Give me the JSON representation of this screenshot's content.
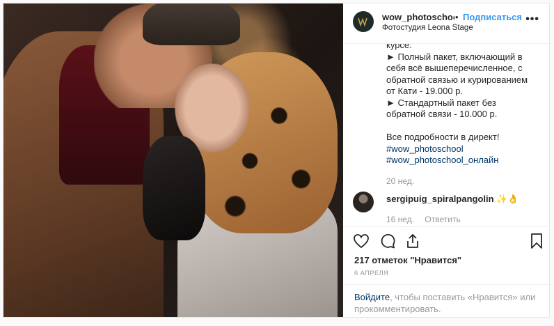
{
  "header": {
    "username": "wow_photoschool",
    "separator": "•",
    "follow_label": "Подписаться",
    "location": "Фотостудия Leona Stage",
    "more_label": "•••"
  },
  "caption": {
    "lines": [
      "курсе:",
      "► Полный пакет, включающий в",
      "себя всё вышеперечисленное, с",
      "обратной связью и курированием",
      "от Кати - 19.000 р.",
      "► Стандартный пакет без",
      "обратной связи - 10.000 р.",
      "",
      "Все подробности в директ!"
    ],
    "tags": [
      "#wow_photoschool",
      "#wow_photoschool_онлайн"
    ],
    "time": "20 нед."
  },
  "comment": {
    "username": "sergipuig_spiralpangolin",
    "emoji": "✨👌",
    "time": "16 нед.",
    "reply_label": "Ответить"
  },
  "icons": [
    "heart-icon",
    "comment-icon",
    "share-icon",
    "bookmark-icon"
  ],
  "likes": "217 отметок \"Нравится\"",
  "date": "6 АПРЕЛЯ",
  "login": {
    "link": "Войдите",
    "text": ", чтобы поставить «Нравится» или прокомментировать."
  },
  "colors": {
    "accent": "#3897f0",
    "link": "#003569",
    "muted": "#999999"
  }
}
